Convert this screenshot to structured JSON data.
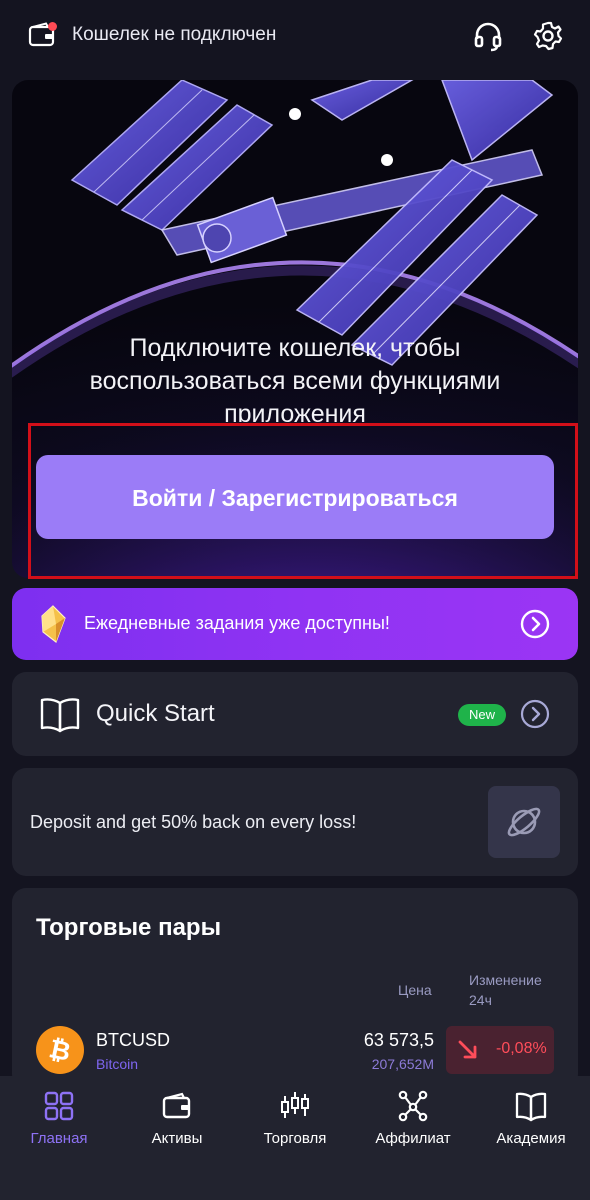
{
  "header": {
    "wallet_status": "Кошелек не подключен",
    "icons": [
      "wallet-icon",
      "headset-icon",
      "gear-icon"
    ]
  },
  "hero": {
    "message": "Подключите кошелек, чтобы воспользоваться всеми функциями приложения",
    "login_button": "Войти / Зарегистрироваться"
  },
  "daily_tasks": {
    "text": "Ежедневные задания уже доступны!",
    "icon": "crystal-icon"
  },
  "quick_start": {
    "title": "Quick Start",
    "badge": "New",
    "icon": "book-icon"
  },
  "promo": {
    "text": "Deposit and get 50% back on every loss!",
    "icon": "planet-icon"
  },
  "trading_pairs": {
    "title": "Торговые пары",
    "col_price": "Цена",
    "col_change_line1": "Изменение",
    "col_change_line2": "24ч",
    "rows": [
      {
        "symbol": "BTCUSD",
        "name": "Bitcoin",
        "price": "63 573,5",
        "volume": "207,652M",
        "change": "-0,08%"
      }
    ]
  },
  "nav": {
    "items": [
      {
        "label": "Главная",
        "icon": "grid-icon",
        "active": true
      },
      {
        "label": "Активы",
        "icon": "wallet-icon"
      },
      {
        "label": "Торговля",
        "icon": "candles-icon"
      },
      {
        "label": "Аффилиат",
        "icon": "network-icon"
      },
      {
        "label": "Академия",
        "icon": "book-icon"
      }
    ]
  },
  "colors": {
    "background": "#141420",
    "accent": "#9b7cf7",
    "daily_gradient": "#8a32f2",
    "card": "#22232f",
    "negative": "#ff4d5a",
    "badge_green": "#1fb34a",
    "highlight_red": "#d20f19"
  }
}
